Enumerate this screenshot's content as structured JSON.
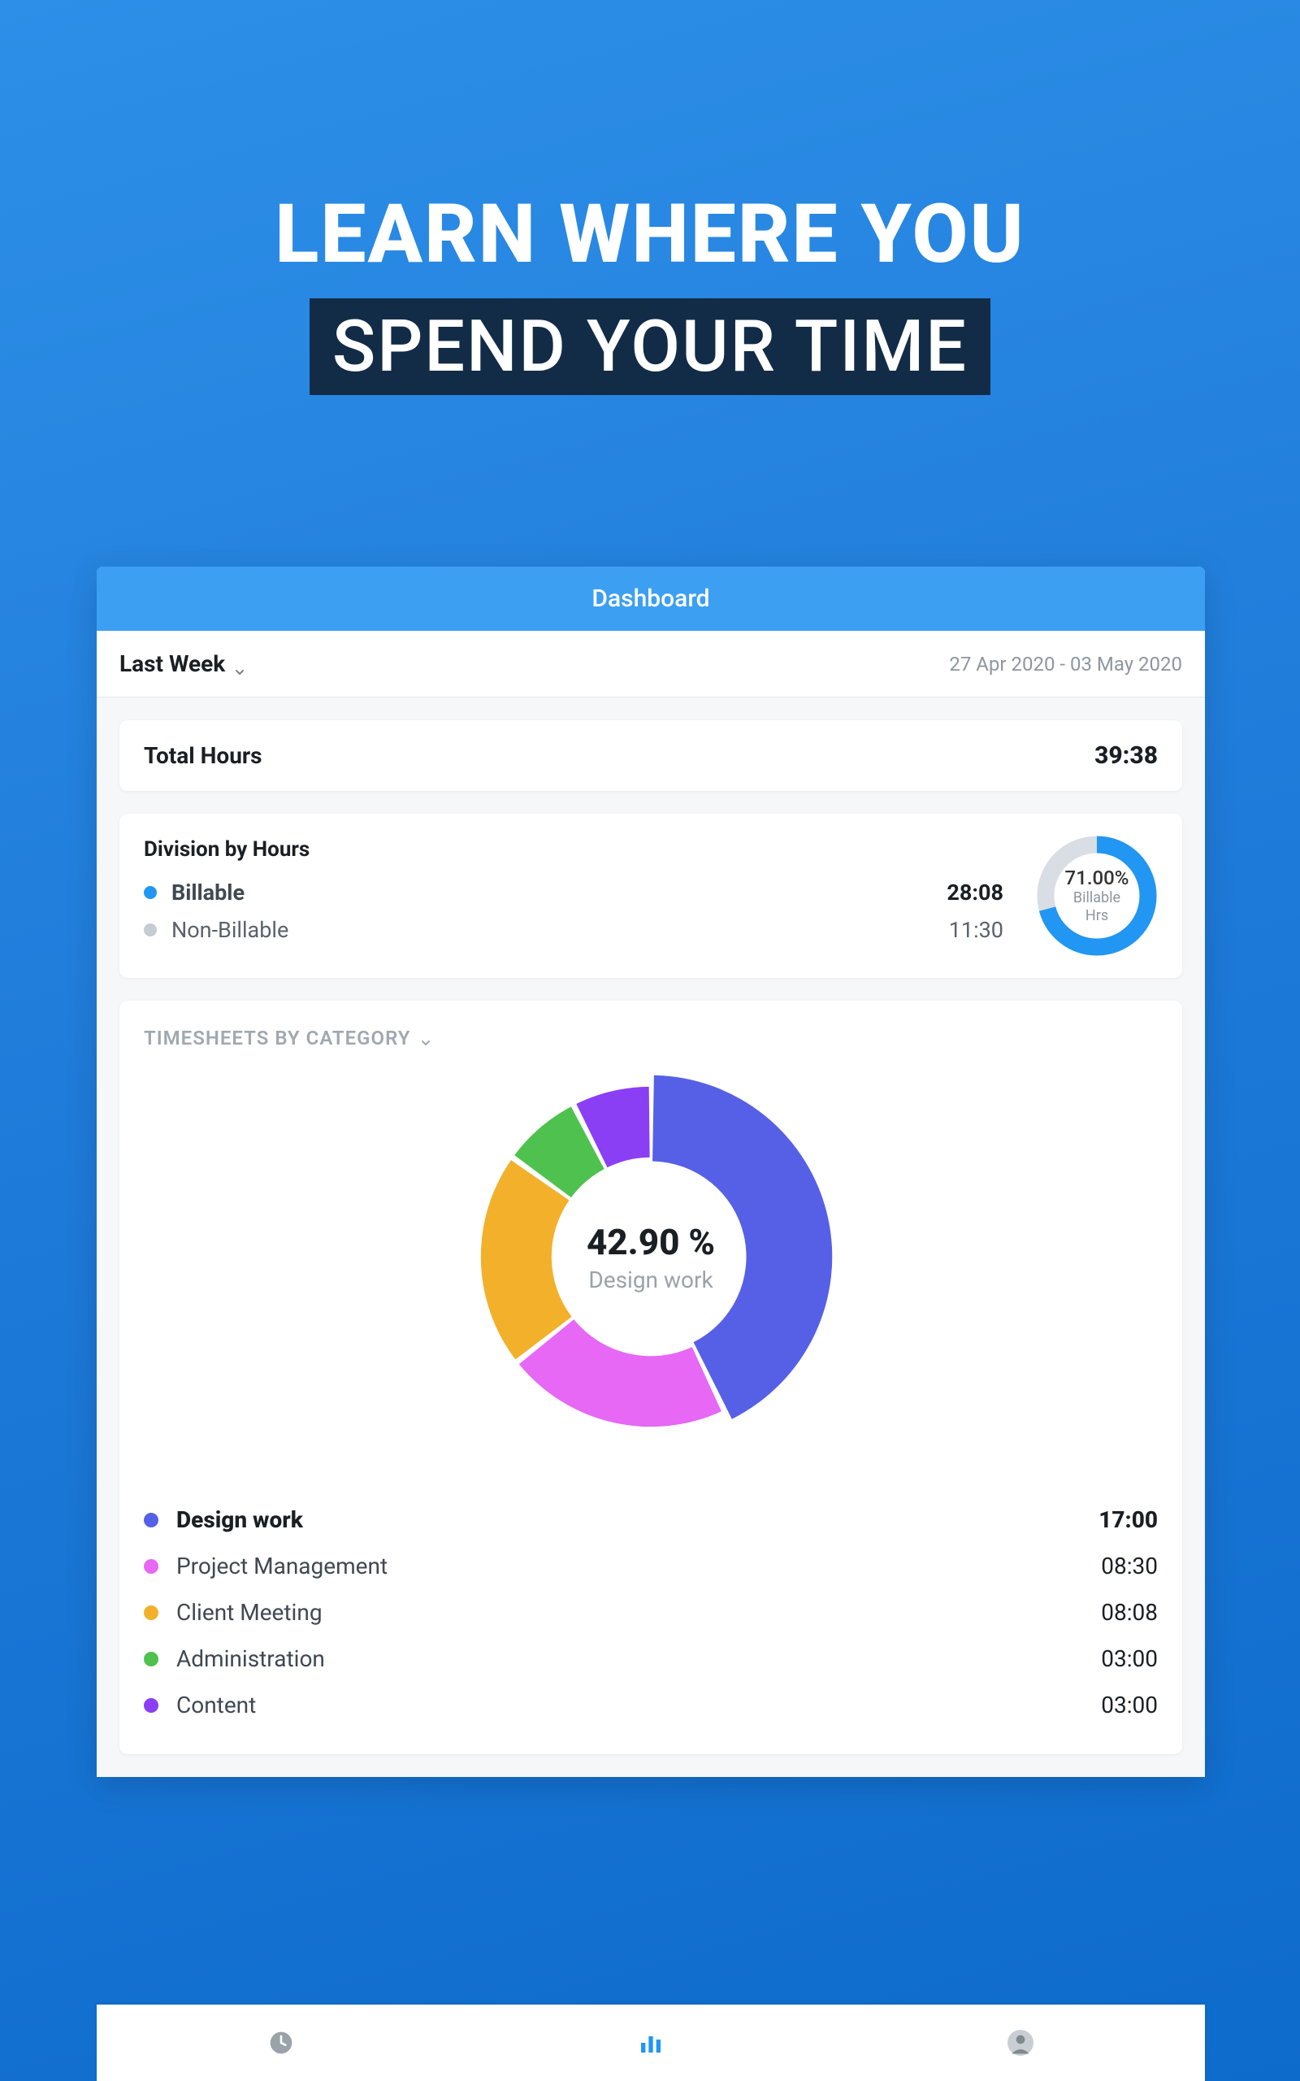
{
  "hero": {
    "line1": "LEARN WHERE YOU",
    "line2": "SPEND YOUR TIME"
  },
  "app": {
    "header_title": "Dashboard",
    "filter": {
      "label": "Last Week",
      "date_range": "27 Apr 2020 - 03 May 2020"
    },
    "total_hours": {
      "title": "Total Hours",
      "value": "39:38"
    },
    "division": {
      "title": "Division by Hours",
      "rows": [
        {
          "label": "Billable",
          "value": "28:08",
          "color": "#2196F3"
        },
        {
          "label": "Non-Billable",
          "value": "11:30",
          "color": "#C5CCD3"
        }
      ],
      "gauge": {
        "percent_text": "71.00%",
        "label_line1": "Billable",
        "label_line2": "Hrs",
        "percent": 71.0
      }
    },
    "category": {
      "header": "TIMESHEETS BY CATEGORY",
      "center_percent": "42.90 %",
      "center_label": "Design work",
      "items": [
        {
          "label": "Design work",
          "value": "17:00",
          "color": "#5660E6",
          "selected": true
        },
        {
          "label": "Project  Management",
          "value": "08:30",
          "color": "#E668F4",
          "selected": false
        },
        {
          "label": "Client Meeting",
          "value": "08:08",
          "color": "#F2B02B",
          "selected": false
        },
        {
          "label": "Administration",
          "value": "03:00",
          "color": "#4FC14F",
          "selected": false
        },
        {
          "label": "Content",
          "value": "03:00",
          "color": "#8A3FF5",
          "selected": false
        }
      ]
    }
  },
  "nav": {
    "items": [
      {
        "name": "clock-icon",
        "active": false
      },
      {
        "name": "bar-chart-icon",
        "active": true
      },
      {
        "name": "avatar-icon",
        "active": false
      }
    ]
  },
  "chart_data": [
    {
      "type": "pie",
      "title": "Division by Hours",
      "categories": [
        "Billable",
        "Non-Billable"
      ],
      "values": [
        71.0,
        29.0
      ],
      "unit": "percent",
      "time_values": [
        "28:08",
        "11:30"
      ],
      "colors": [
        "#2196F3",
        "#C5CCD3"
      ],
      "center_label": "71.00% Billable Hrs"
    },
    {
      "type": "pie",
      "title": "Timesheets by Category",
      "categories": [
        "Design work",
        "Project Management",
        "Client Meeting",
        "Administration",
        "Content"
      ],
      "values": [
        42.9,
        21.5,
        20.5,
        7.6,
        7.6
      ],
      "unit": "percent",
      "time_values": [
        "17:00",
        "08:30",
        "08:08",
        "03:00",
        "03:00"
      ],
      "colors": [
        "#5660E6",
        "#E668F4",
        "#F2B02B",
        "#4FC14F",
        "#8A3FF5"
      ],
      "center_label": "42.90 % Design work"
    }
  ]
}
